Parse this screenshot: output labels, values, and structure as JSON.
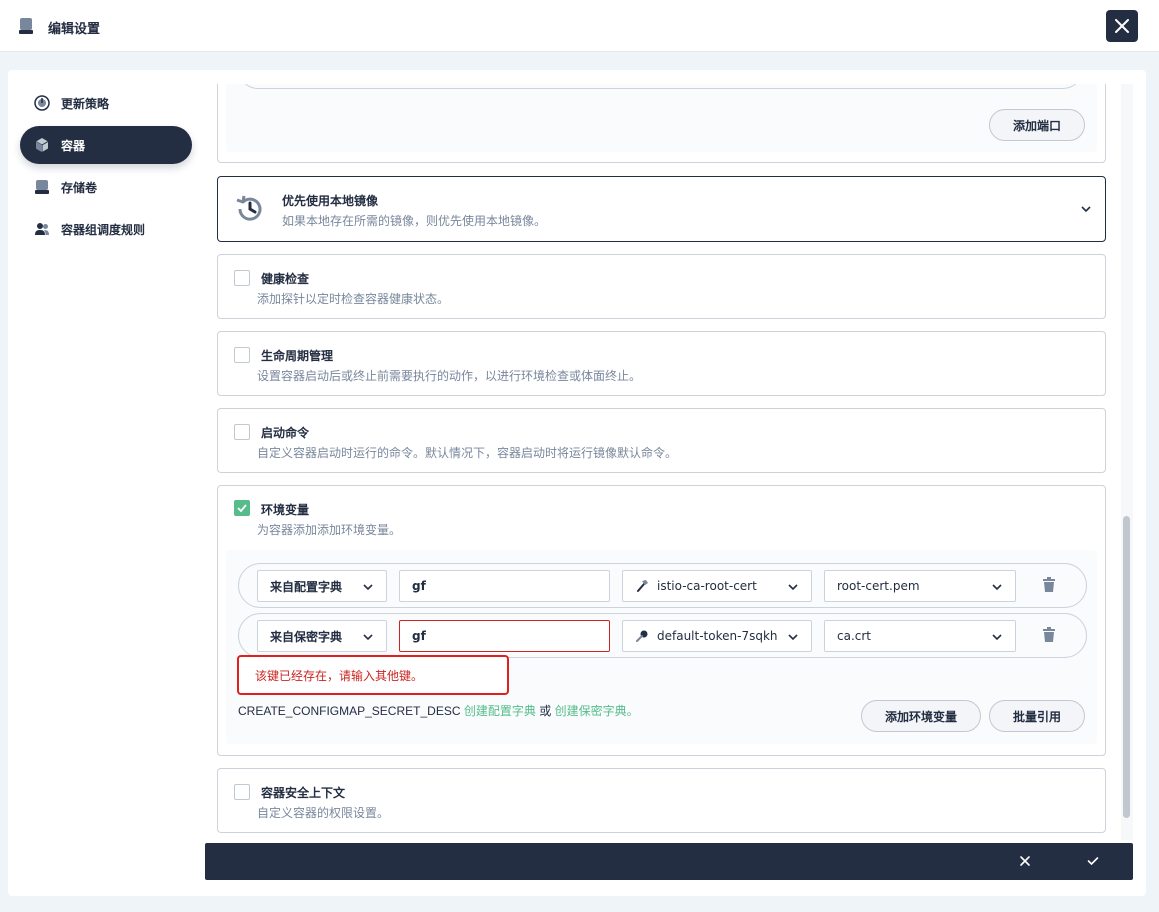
{
  "header": {
    "title": "编辑设置"
  },
  "nav": {
    "items": [
      {
        "label": "更新策略",
        "icon": "clock-icon"
      },
      {
        "label": "容器",
        "icon": "cube-icon"
      },
      {
        "label": "存储卷",
        "icon": "storage-icon"
      },
      {
        "label": "容器组调度规则",
        "icon": "users-icon"
      }
    ],
    "active": 1
  },
  "ports": {
    "add_port_label": "添加端口"
  },
  "local_image": {
    "title": "优先使用本地镜像",
    "desc": "如果本地存在所需的镜像，则优先使用本地镜像。"
  },
  "health_check": {
    "title": "健康检查",
    "desc": "添加探针以定时检查容器健康状态。",
    "checked": false
  },
  "lifecycle": {
    "title": "生命周期管理",
    "desc": "设置容器启动后或终止前需要执行的动作，以进行环境检查或体面终止。",
    "checked": false
  },
  "start_cmd": {
    "title": "启动命令",
    "desc": "自定义容器启动时运行的命令。默认情况下，容器启动时将运行镜像默认命令。",
    "checked": false
  },
  "env": {
    "title": "环境变量",
    "desc": "为容器添加添加环境变量。",
    "checked": true,
    "rows": [
      {
        "source": "来自配置字典",
        "key": "gf",
        "resource": "istio-ca-root-cert",
        "resource_icon": "hammer-icon",
        "item": "root-cert.pem",
        "error": false
      },
      {
        "source": "来自保密字典",
        "key": "gf",
        "resource": "default-token-7sqkh",
        "resource_icon": "key-icon",
        "item": "ca.crt",
        "error": true
      }
    ],
    "error_message": "该键已经存在，请输入其他键。",
    "footer_text": "CREATE_CONFIGMAP_SECRET_DESC",
    "link_configmap": "创建配置字典",
    "or_text": "或",
    "link_secret": "创建保密字典。",
    "add_env_label": "添加环境变量",
    "batch_ref_label": "批量引用"
  },
  "security_context": {
    "title": "容器安全上下文",
    "desc": "自定义容器的权限设置。",
    "checked": false
  },
  "colors": {
    "dark": "#242e42",
    "green": "#55bc8a",
    "error": "#ca2621"
  }
}
